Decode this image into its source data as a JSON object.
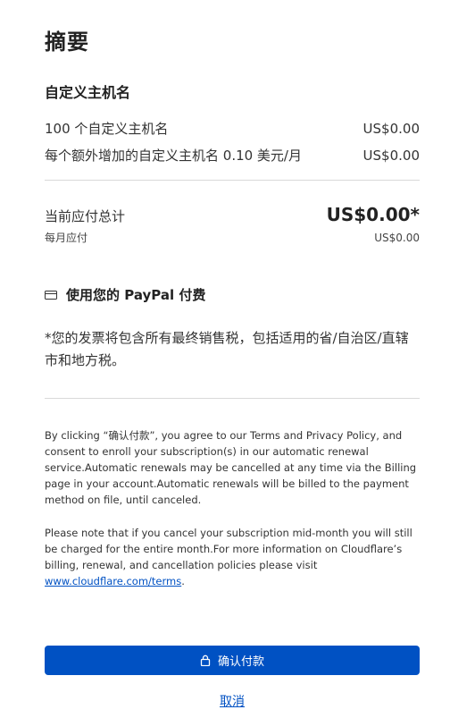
{
  "summary": {
    "title": "摘要",
    "section_title": "自定义主机名",
    "items": [
      {
        "label": "100 个自定义主机名",
        "price": "US$0.00"
      },
      {
        "label": "每个额外增加的自定义主机名 0.10 美元/月",
        "price": "US$0.00"
      }
    ],
    "total_label": "当前应付总计",
    "total_amount": "US$0.00*",
    "monthly_label": "每月应付",
    "monthly_amount": "US$0.00"
  },
  "payment": {
    "icon": "credit-card-icon",
    "label": "使用您的 PayPal 付费"
  },
  "tax_note": "*您的发票将包含所有最终销售税，包括适用的省/自治区/直辖市和地方税。",
  "legal": {
    "paragraph1": "By clicking “确认付款”, you agree to our Terms and Privacy Policy, and consent to enroll your subscription(s) in our automatic renewal service.Automatic renewals may be cancelled at any time via the Billing page in your account.Automatic renewals will be billed to the payment method on file, until canceled.",
    "paragraph2": "Please note that if you cancel your subscription mid-month you will still be charged for the entire month.For more information on Cloudflare’s billing, renewal, and cancellation policies please visit",
    "link_text": "www.cloudflare.com/terms",
    "link_suffix": "."
  },
  "actions": {
    "confirm_label": "确认付款",
    "confirm_icon": "lock-icon",
    "cancel_label": "取消"
  },
  "colors": {
    "accent": "#0051c3",
    "divider": "#d9d9d9"
  }
}
